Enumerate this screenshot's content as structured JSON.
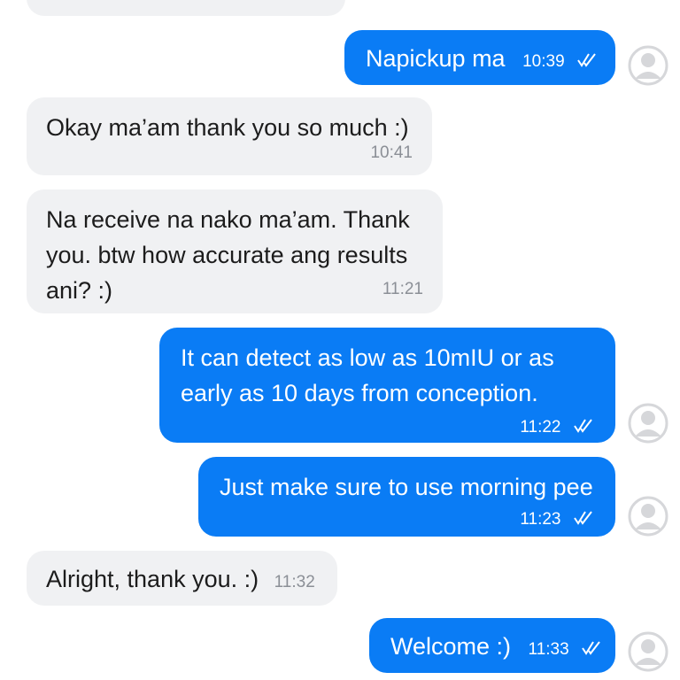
{
  "messages": [
    {
      "text": "Napickup ma",
      "time": "10:39"
    },
    {
      "text": "Okay ma’am thank you so much :)",
      "time": "10:41"
    },
    {
      "lines": [
        "Na receive na nako ma’am. Thank",
        "you. btw how accurate ang results",
        "ani? :)"
      ],
      "time": "11:21"
    },
    {
      "lines": [
        "It can detect as low as 10mIU or as",
        "early as 10 days from conception."
      ],
      "time": "11:22"
    },
    {
      "text": "Just make sure to use morning pee",
      "time": "11:23"
    },
    {
      "text": "Alright, thank you. :)",
      "time": "11:32"
    },
    {
      "text": "Welcome :)",
      "time": "11:33"
    }
  ],
  "colors": {
    "outgoing_bubble": "#0a7cf5",
    "incoming_bubble": "#f0f1f3",
    "avatar": "#d6d7da"
  },
  "icons": {
    "read_receipt": "double-check-icon",
    "avatar": "default-avatar-icon"
  }
}
